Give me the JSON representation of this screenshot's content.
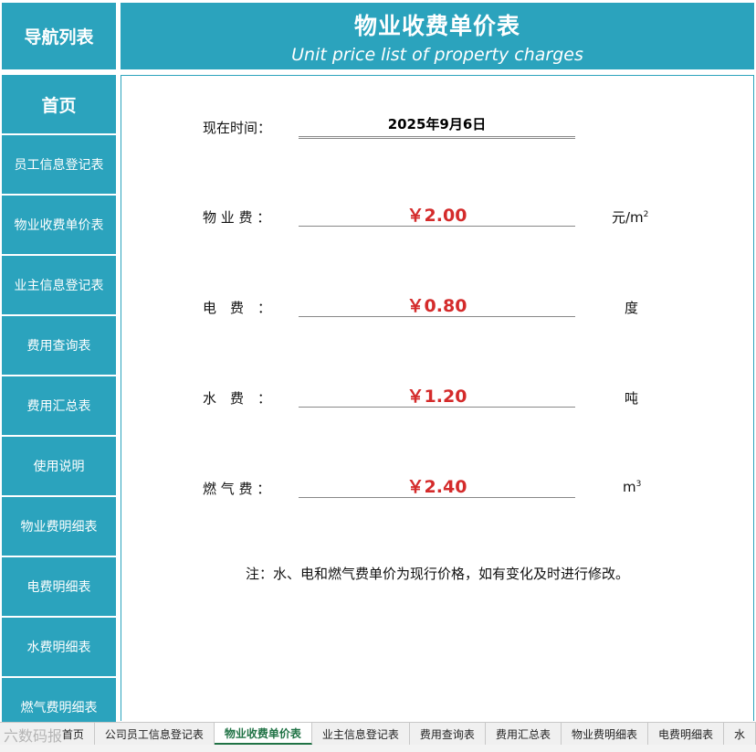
{
  "nav": {
    "title": "导航列表",
    "items": [
      "首页",
      "员工信息登记表",
      "物业收费单价表",
      "业主信息登记表",
      "费用查询表",
      "费用汇总表",
      "使用说明",
      "物业费明细表",
      "电费明细表",
      "水费明细表",
      "燃气费明细表"
    ]
  },
  "header": {
    "title": "物业收费单价表",
    "subtitle": "Unit price list of property charges"
  },
  "date": {
    "label": "现在时间：",
    "value": "2025年9月6日"
  },
  "prices": [
    {
      "label": "物 业 费 ：",
      "value": "￥2.00",
      "unit": "元/m",
      "sup": "2"
    },
    {
      "label": "电　费　：",
      "value": "￥0.80",
      "unit": "度",
      "sup": ""
    },
    {
      "label": "水　费　：",
      "value": "￥1.20",
      "unit": "吨",
      "sup": ""
    },
    {
      "label": "燃 气 费 ：",
      "value": "￥2.40",
      "unit": "m",
      "sup": "3"
    }
  ],
  "note": "注：水、电和燃气费单价为现行价格，如有变化及时进行修改。",
  "tabs": [
    "首页",
    "公司员工信息登记表",
    "物业收费单价表",
    "业主信息登记表",
    "费用查询表",
    "费用汇总表",
    "物业费明细表",
    "电费明细表",
    "水"
  ],
  "active_tab": "物业收费单价表",
  "watermark": "六数码报",
  "colors": {
    "accent": "#2ba3bd",
    "price": "#d42b2b",
    "active_tab": "#217346"
  }
}
